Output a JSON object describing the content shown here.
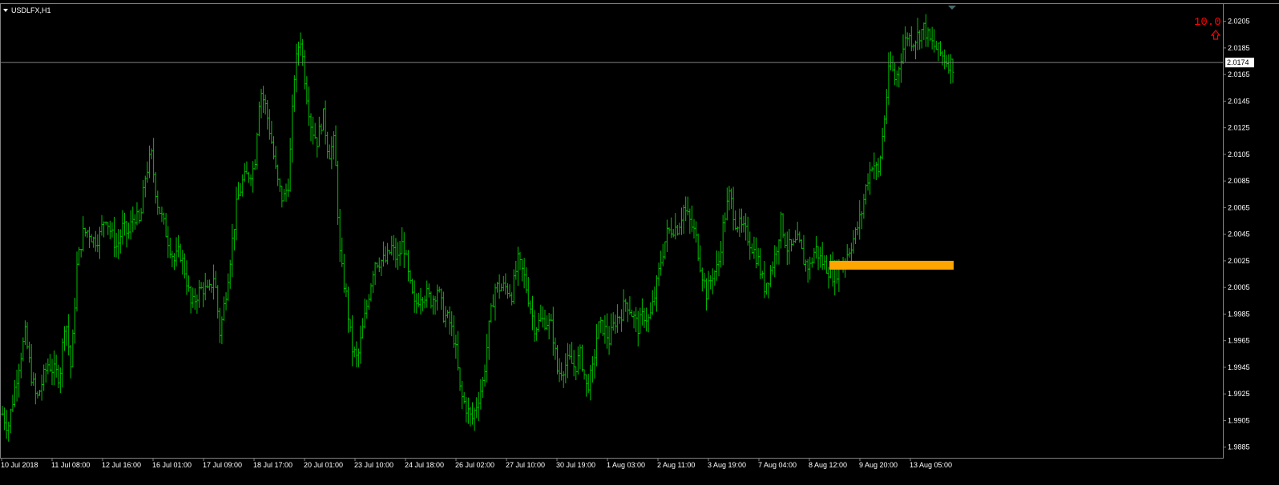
{
  "window": {
    "symbol_title": "USDLFX,H1"
  },
  "indicator": {
    "value": "10.0",
    "color": "#ff0000",
    "icon": "arrow-up-outline-icon"
  },
  "colors": {
    "background": "#000000",
    "bars": "#00c000",
    "grid": "#808080",
    "axis_text": "#ffffff",
    "level_bar": "#ffa500",
    "current_price_line": "#808080"
  },
  "chart_data": {
    "type": "line",
    "symbol": "USDLFX",
    "timeframe": "H1",
    "current_price": 2.0174,
    "ylim": [
      1.9877,
      2.0218
    ],
    "yticks": [
      "2.0205",
      "2.0185",
      "2.0165",
      "2.0145",
      "2.0125",
      "2.0105",
      "2.0085",
      "2.0065",
      "2.0045",
      "2.0025",
      "2.0005",
      "1.9985",
      "1.9965",
      "1.9945",
      "1.9925",
      "1.9905",
      "1.9885"
    ],
    "xticks": [
      "10 Jul 2018",
      "11 Jul 08:00",
      "12 Jul 16:00",
      "16 Jul 01:00",
      "17 Jul 09:00",
      "18 Jul 17:00",
      "20 Jul 01:00",
      "23 Jul 10:00",
      "24 Jul 18:00",
      "26 Jul 02:00",
      "27 Jul 10:00",
      "30 Jul 19:00",
      "1 Aug 03:00",
      "2 Aug 11:00",
      "3 Aug 19:00",
      "7 Aug 04:00",
      "8 Aug 12:00",
      "9 Aug 20:00",
      "13 Aug 05:00"
    ],
    "series": [
      {
        "values": [
          1.991,
          1.99,
          1.9925,
          1.995,
          1.997,
          1.994,
          1.992,
          1.9935,
          1.9948,
          1.9942,
          1.9938,
          1.9985,
          1.9943,
          2.002,
          2.0045,
          2.0048,
          2.004,
          2.0044,
          2.006,
          2.0045,
          2.0035,
          2.005,
          2.0045,
          2.006,
          2.0052,
          2.009,
          2.0105,
          2.007,
          2.0055,
          2.004,
          2.0025,
          2.0032,
          2.0015,
          1.999,
          2.0,
          2.0005,
          2.0,
          2.0015,
          1.997,
          2.0,
          2.0035,
          2.007,
          2.0085,
          2.009,
          2.0095,
          2.0155,
          2.014,
          2.0115,
          2.0085,
          2.007,
          2.0085,
          2.0165,
          2.0195,
          2.0155,
          2.0125,
          2.0115,
          2.0135,
          2.0105,
          2.0115,
          2.0025,
          2.0,
          1.996,
          1.995,
          1.9975,
          2.0,
          2.0025,
          2.0025,
          2.0025,
          2.0035,
          2.0025,
          2.004,
          2.001,
          1.999,
          2.0,
          2.0,
          1.9995,
          2.0005,
          1.9985,
          1.998,
          1.9965,
          1.9925,
          1.9915,
          1.9905,
          1.992,
          1.9935,
          1.9975,
          2.0005,
          2.0005,
          2.0005,
          2.0,
          2.0025,
          2.0015,
          1.9995,
          1.9975,
          1.998,
          1.998,
          1.9975,
          1.994,
          1.9945,
          1.995,
          1.9945,
          1.9955,
          1.993,
          1.994,
          1.9975,
          1.9975,
          1.9965,
          1.998,
          1.9985,
          1.9995,
          1.9985,
          1.9975,
          1.9985,
          1.998,
          2.0,
          2.0025,
          2.0045,
          2.005,
          2.005,
          2.0065,
          2.0055,
          2.0045,
          2.002,
          2.0,
          2.0015,
          2.002,
          2.0055,
          2.0075,
          2.0055,
          2.005,
          2.0045,
          2.0035,
          2.0025,
          2.0005,
          2.0015,
          2.003,
          2.0055,
          2.0035,
          2.0035,
          2.004,
          2.0025,
          2.002,
          2.0035,
          2.0025,
          2.002,
          2.0015,
          2.0018,
          2.0025,
          2.0035,
          2.0045,
          2.006,
          2.0085,
          2.01,
          2.009,
          2.013,
          2.0175,
          2.016,
          2.018,
          2.0195,
          2.019,
          2.0195,
          2.02,
          2.019,
          2.0185,
          2.018,
          2.0175,
          2.0172
        ]
      }
    ],
    "annotations": [
      {
        "type": "horizontal-level",
        "price": 2.0022,
        "start_time": "8 Aug 12:00",
        "color": "#ffa500"
      }
    ]
  }
}
